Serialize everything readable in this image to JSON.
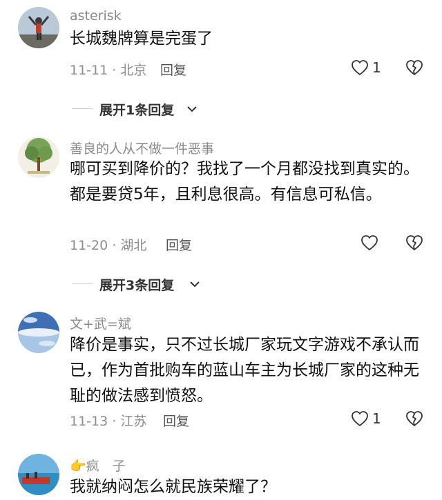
{
  "comments": [
    {
      "username": "asterisk",
      "content": "长城魏牌算是完蛋了",
      "meta": "11-11 · 北京",
      "reply_label": "回复",
      "like_count": "1",
      "expand_label": "展开1条回复"
    },
    {
      "username": "善良的人从不做一件恶事",
      "content": "哪可买到降价的？我找了一个月都没找到真实的。都是要贷5年，且利息很高。有信息可私信。",
      "meta": "11-20 · 湖北",
      "reply_label": "回复",
      "like_count": "",
      "expand_label": "展开3条回复"
    },
    {
      "username": "文+武=斌",
      "content": "降价是事实，只不过长城厂家玩文字游戏不承认而已，作为首批购车的蓝山车主为长城厂家的这种无耻的做法感到愤怒。",
      "meta": "11-13 · 江苏",
      "reply_label": "回复",
      "like_count": "1"
    },
    {
      "username_prefix": "👉",
      "username": "疯　子",
      "content": "我就纳闷怎么就民族荣耀了？"
    }
  ],
  "icons": {
    "like": "heart-outline-icon",
    "dislike": "broken-heart-icon",
    "expand": "chevron-down-icon"
  },
  "colors": {
    "username": "#8a8a8a",
    "content": "#111111",
    "meta": "#8c8c8c"
  }
}
